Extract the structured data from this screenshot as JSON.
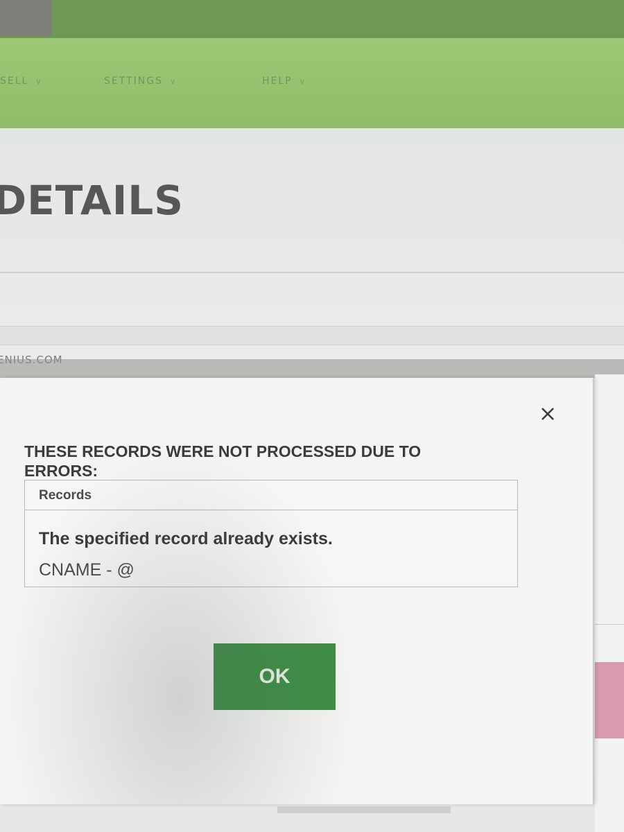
{
  "nav": {
    "items": [
      {
        "label": "SELL",
        "chevron": "chevron-down-icon"
      },
      {
        "label": "SETTINGS",
        "chevron": "chevron-down-icon"
      },
      {
        "label": "HELP",
        "chevron": "chevron-down-icon"
      }
    ]
  },
  "page": {
    "title": "DETAILS",
    "domain_label": "ENIUS.COM"
  },
  "modal": {
    "close_icon": "close-icon",
    "heading": "THESE RECORDS WERE NOT PROCESSED DUE TO ERRORS:",
    "table": {
      "header": "Records",
      "message": "The specified record already exists.",
      "detail": "CNAME - @"
    },
    "ok_label": "OK"
  },
  "colors": {
    "nav_green": "#9ec776",
    "button_green": "#3f8f46",
    "accent_pink": "#d79ab0"
  }
}
